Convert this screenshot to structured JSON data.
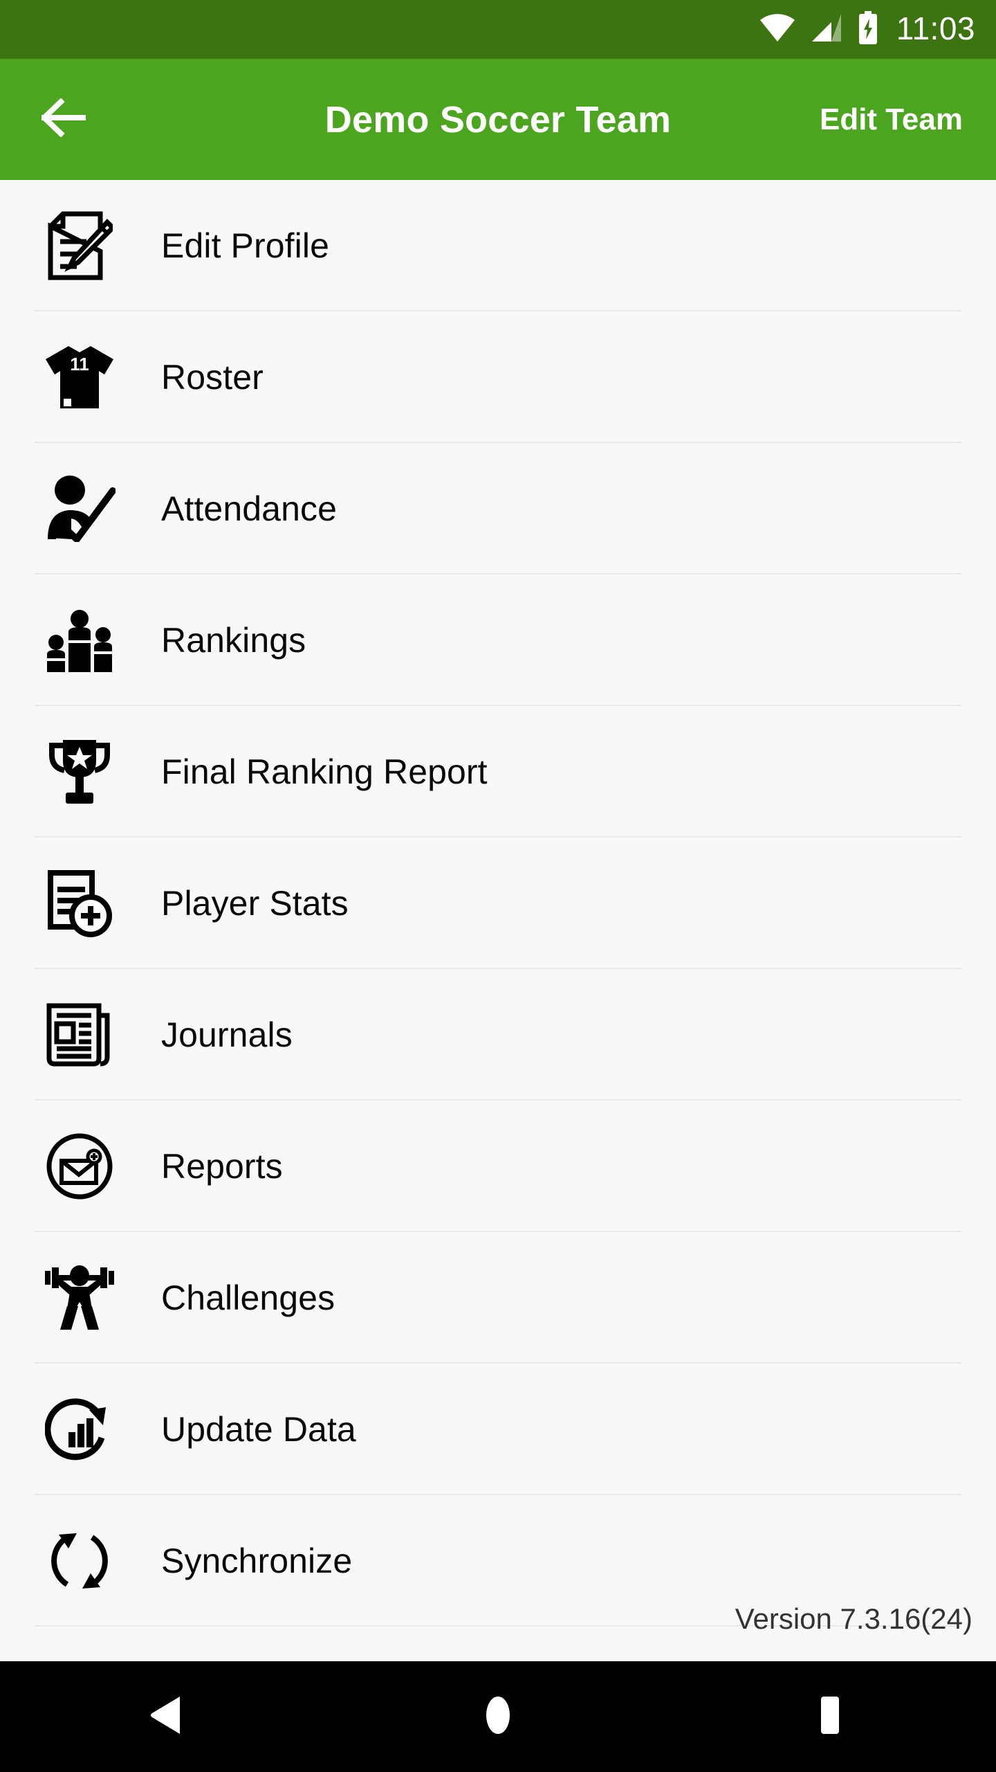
{
  "status_bar": {
    "time": "11:03",
    "icons": [
      "wifi-icon",
      "cellular-signal-icon",
      "battery-charging-icon"
    ],
    "background_color": "#3C7412"
  },
  "app_bar": {
    "back_label": "back-arrow-icon",
    "title": "Demo Soccer Team",
    "action_label": "Edit Team",
    "background_color": "#4CA51E",
    "text_color": "#FFFFFF"
  },
  "menu": {
    "items": [
      {
        "label": "Edit Profile",
        "icon": "document-pencil-icon"
      },
      {
        "label": "Roster",
        "icon": "jersey-icon",
        "badge": "11"
      },
      {
        "label": "Attendance",
        "icon": "person-check-icon"
      },
      {
        "label": "Rankings",
        "icon": "podium-people-icon"
      },
      {
        "label": "Final Ranking Report",
        "icon": "trophy-star-icon"
      },
      {
        "label": "Player Stats",
        "icon": "document-plus-icon"
      },
      {
        "label": "Journals",
        "icon": "newspaper-icon"
      },
      {
        "label": "Reports",
        "icon": "envelope-circle-icon"
      },
      {
        "label": "Challenges",
        "icon": "weightlifter-icon"
      },
      {
        "label": "Update Data",
        "icon": "chart-refresh-icon"
      },
      {
        "label": "Synchronize",
        "icon": "sync-arrows-icon"
      }
    ]
  },
  "footer": {
    "version": "Version 7.3.16(24)"
  },
  "nav_bar": {
    "buttons": [
      "back-triangle-icon",
      "home-circle-icon",
      "recents-square-icon"
    ],
    "background_color": "#000000"
  },
  "page": {
    "background_color": "#F8F8F8",
    "divider_color": "#E8E8E8"
  }
}
